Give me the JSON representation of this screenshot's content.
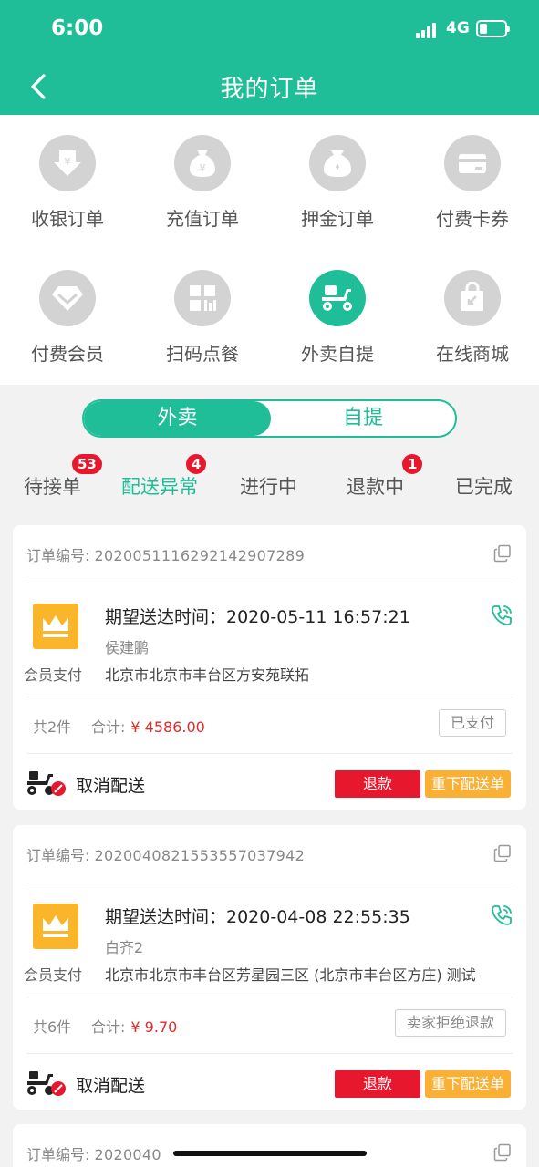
{
  "status_bar": {
    "time": "6:00",
    "network": "4G"
  },
  "header": {
    "title": "我的订单"
  },
  "grid": [
    {
      "label": "收银订单",
      "icon": "cashier-order-icon"
    },
    {
      "label": "充值订单",
      "icon": "recharge-order-icon"
    },
    {
      "label": "押金订单",
      "icon": "deposit-order-icon"
    },
    {
      "label": "付费卡券",
      "icon": "paid-card-icon"
    },
    {
      "label": "付费会员",
      "icon": "paid-member-icon"
    },
    {
      "label": "扫码点餐",
      "icon": "scan-order-icon"
    },
    {
      "label": "外卖自提",
      "icon": "takeout-pickup-icon",
      "active": true
    },
    {
      "label": "在线商城",
      "icon": "online-mall-icon"
    }
  ],
  "segment": {
    "left": "外卖",
    "right": "自提",
    "selected": "外卖"
  },
  "tabs": [
    {
      "label": "待接单",
      "badge": "53"
    },
    {
      "label": "配送异常",
      "badge": "4",
      "active": true
    },
    {
      "label": "进行中"
    },
    {
      "label": "退款中",
      "badge": "1"
    },
    {
      "label": "已完成"
    }
  ],
  "orders": [
    {
      "order_label": "订单编号:",
      "order_no": "2020051116292142907289",
      "expect": "期望送达时间：2020-05-11 16:57:21",
      "name": "侯建鹏",
      "pay_label": "会员支付",
      "address": "北京市北京市丰台区方安苑联拓",
      "count": "共2件",
      "total_label": "合计:",
      "total": "¥ 4586.00",
      "status": "已支付",
      "delivery_status": "取消配送",
      "refund_label": "退款",
      "redeliver_label": "重下配送单"
    },
    {
      "order_label": "订单编号:",
      "order_no": "2020040821553557037942",
      "expect": "期望送达时间：2020-04-08 22:55:35",
      "name": "白齐2",
      "pay_label": "会员支付",
      "address": "北京市北京市丰台区芳星园三区 (北京市丰台区方庄) 测试",
      "count": "共6件",
      "total_label": "合计:",
      "total": "¥ 9.70",
      "status": "卖家拒绝退款",
      "delivery_status": "取消配送",
      "refund_label": "退款",
      "redeliver_label": "重下配送单"
    },
    {
      "order_label": "订单编号:",
      "order_no": "2020040"
    }
  ]
}
